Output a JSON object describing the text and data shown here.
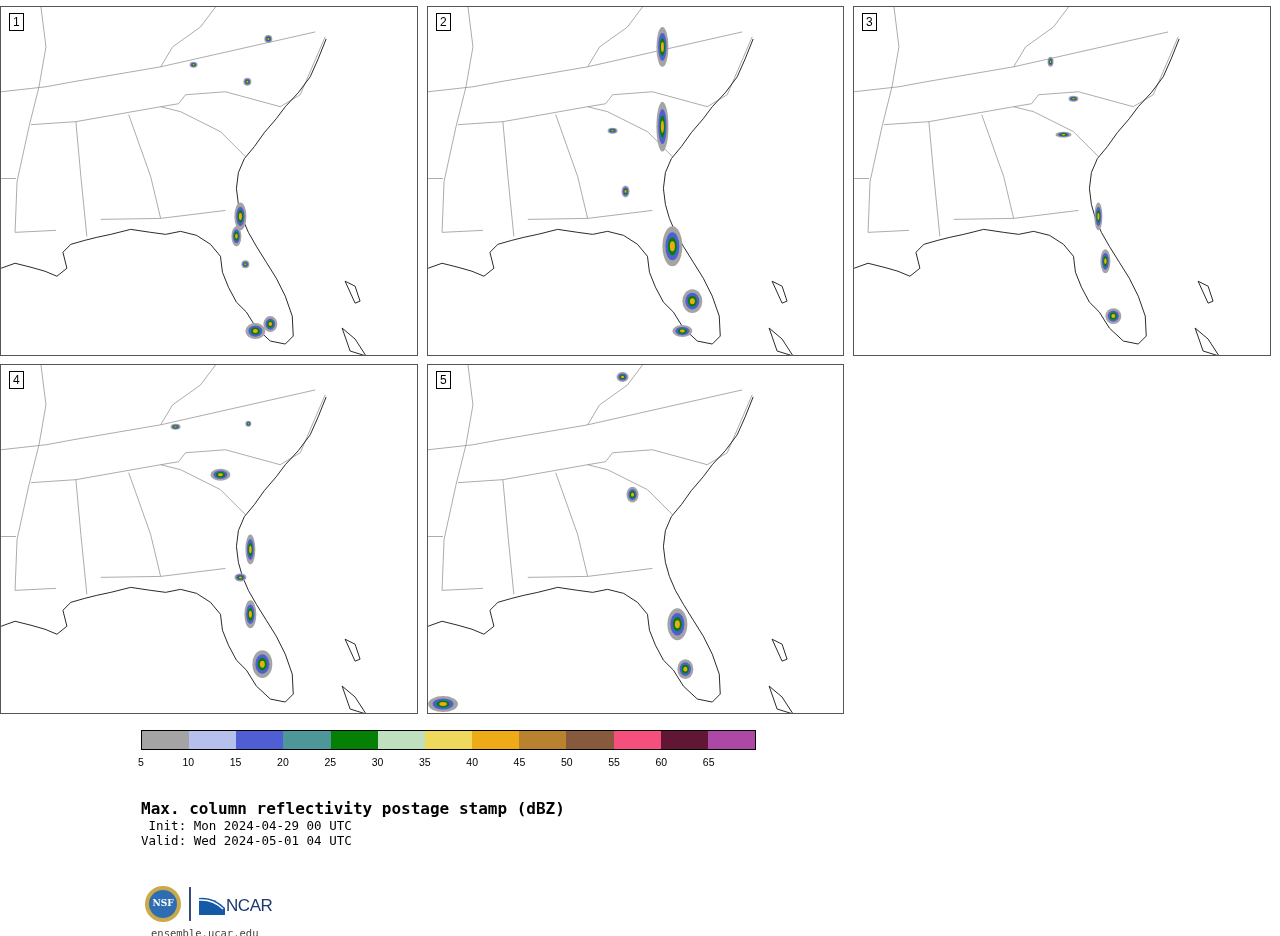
{
  "panels": [
    {
      "label": "1"
    },
    {
      "label": "2"
    },
    {
      "label": "3"
    },
    {
      "label": "4"
    },
    {
      "label": "5"
    }
  ],
  "colorbar": {
    "segments": [
      {
        "color": "#a4a4a4",
        "tick": "5"
      },
      {
        "color": "#b5c1ec",
        "tick": "10"
      },
      {
        "color": "#505ed6",
        "tick": "15"
      },
      {
        "color": "#4d979a",
        "tick": "20"
      },
      {
        "color": "#048104",
        "tick": "25"
      },
      {
        "color": "#bfdfbf",
        "tick": "30"
      },
      {
        "color": "#eed95c",
        "tick": "35"
      },
      {
        "color": "#eeaa17",
        "tick": "40"
      },
      {
        "color": "#b9822f",
        "tick": "45"
      },
      {
        "color": "#875a3e",
        "tick": "50"
      },
      {
        "color": "#f44f7d",
        "tick": "55"
      },
      {
        "color": "#621636",
        "tick": "60"
      },
      {
        "color": "#ad48a7",
        "tick": "65"
      }
    ]
  },
  "title": "Max. column reflectivity postage stamp (dBZ)",
  "init": " Init: Mon 2024-04-29 00 UTC",
  "valid": "Valid: Wed 2024-05-01 04 UTC",
  "logo": {
    "nsf": "NSF",
    "ncar": "NCAR"
  },
  "url": "ensemble.ucar.edu"
}
